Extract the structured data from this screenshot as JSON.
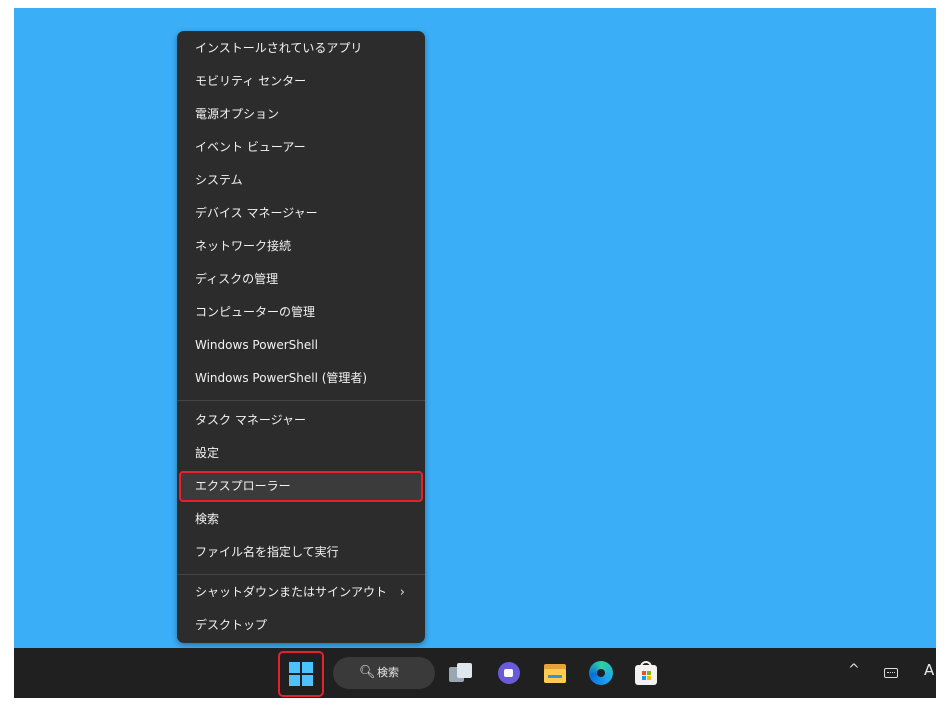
{
  "context_menu": {
    "items": [
      {
        "label": "インストールされているアプリ"
      },
      {
        "label": "モビリティ センター"
      },
      {
        "label": "電源オプション"
      },
      {
        "label": "イベント ビューアー"
      },
      {
        "label": "システム"
      },
      {
        "label": "デバイス マネージャー"
      },
      {
        "label": "ネットワーク接続"
      },
      {
        "label": "ディスクの管理"
      },
      {
        "label": "コンピューターの管理"
      },
      {
        "label": "Windows PowerShell"
      },
      {
        "label": "Windows PowerShell (管理者)"
      },
      {
        "label": "タスク マネージャー"
      },
      {
        "label": "設定"
      },
      {
        "label": "エクスプローラー"
      },
      {
        "label": "検索"
      },
      {
        "label": "ファイル名を指定して実行"
      },
      {
        "label": "シャットダウンまたはサインアウト",
        "submenu_glyph": "›"
      },
      {
        "label": "デスクトップ"
      }
    ],
    "highlighted_item": "エクスプローラー"
  },
  "taskbar": {
    "search_label": "検索",
    "search_icon": "magnifier-icon",
    "apps": [
      "start-icon",
      "task-view-icon",
      "chat-icon",
      "file-explorer-icon",
      "edge-icon",
      "store-icon"
    ],
    "tray": {
      "overflow_glyph": "^",
      "ime_indicator": "A"
    }
  },
  "colors": {
    "desktop": "#3aaef6",
    "menu_background": "#2c2c2c",
    "taskbar": "#202020",
    "highlight_border": "#e8202c"
  }
}
